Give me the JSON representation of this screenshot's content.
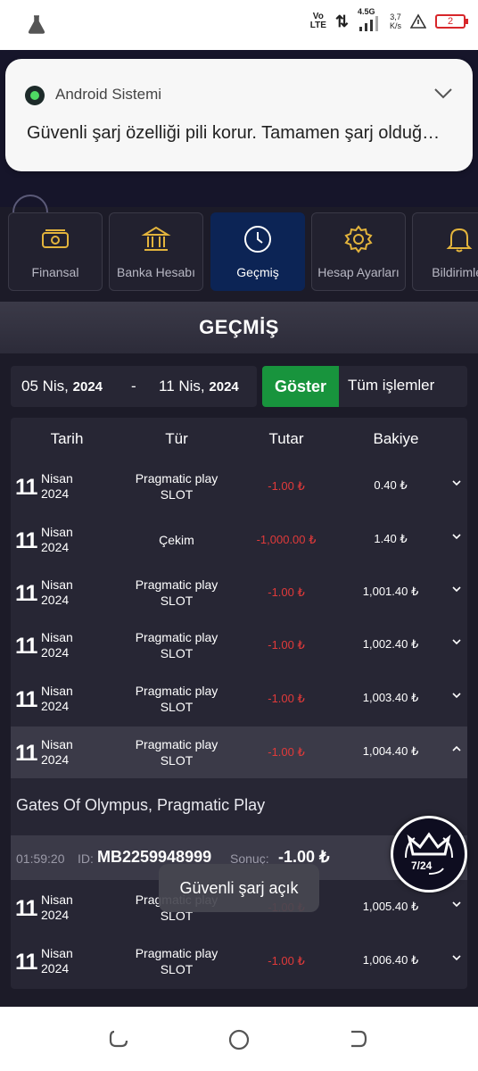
{
  "status_bar": {
    "volte": [
      "Vo",
      "LTE"
    ],
    "network": "4.5G",
    "speed": [
      "3,7",
      "K/s"
    ],
    "battery": "2",
    "icons": [
      "flask-icon",
      "signal-icon",
      "alert-icon",
      "battery-icon"
    ]
  },
  "notification": {
    "app_name": "Android Sistemi",
    "message": "Güvenli şarj özelliği pili korur. Tamamen şarj olduğ…"
  },
  "tabs": [
    {
      "label": "Finansal",
      "icon": "money-icon",
      "active": false
    },
    {
      "label": "Banka Hesabı",
      "icon": "bank-icon",
      "active": false
    },
    {
      "label": "Geçmiş",
      "icon": "clock-icon",
      "active": true
    },
    {
      "label": "Hesap Ayarları",
      "icon": "gear-icon",
      "active": false
    },
    {
      "label": "Bildirimler",
      "icon": "bell-icon",
      "active": false
    }
  ],
  "page_title": "GEÇMİŞ",
  "filter": {
    "start_day": "05 Nis,",
    "start_year": "2024",
    "separator": "-",
    "end_day": "11 Nis,",
    "end_year": "2024",
    "show_button": "Göster",
    "type_select": "Tüm işlemler"
  },
  "table": {
    "headers": {
      "date": "Tarih",
      "type": "Tür",
      "amount": "Tutar",
      "balance": "Bakiye"
    },
    "rows": [
      {
        "day": "11",
        "month": "Nisan",
        "year": "2024",
        "type1": "Pragmatic play",
        "type2": "SLOT",
        "amount": "-1.00 ₺",
        "balance": "0.40 ₺"
      },
      {
        "day": "11",
        "month": "Nisan",
        "year": "2024",
        "type1": "Çekim",
        "type2": "",
        "amount": "-1,000.00 ₺",
        "balance": "1.40 ₺"
      },
      {
        "day": "11",
        "month": "Nisan",
        "year": "2024",
        "type1": "Pragmatic play",
        "type2": "SLOT",
        "amount": "-1.00 ₺",
        "balance": "1,001.40 ₺"
      },
      {
        "day": "11",
        "month": "Nisan",
        "year": "2024",
        "type1": "Pragmatic play",
        "type2": "SLOT",
        "amount": "-1.00 ₺",
        "balance": "1,002.40 ₺"
      },
      {
        "day": "11",
        "month": "Nisan",
        "year": "2024",
        "type1": "Pragmatic play",
        "type2": "SLOT",
        "amount": "-1.00 ₺",
        "balance": "1,003.40 ₺"
      },
      {
        "day": "11",
        "month": "Nisan",
        "year": "2024",
        "type1": "Pragmatic play",
        "type2": "SLOT",
        "amount": "-1.00 ₺",
        "balance": "1,004.40 ₺"
      },
      {
        "day": "11",
        "month": "Nisan",
        "year": "2024",
        "type1": "Pragmatic play",
        "type2": "SLOT",
        "amount": "-1.00 ₺",
        "balance": "1,005.40 ₺"
      },
      {
        "day": "11",
        "month": "Nisan",
        "year": "2024",
        "type1": "Pragmatic play",
        "type2": "SLOT",
        "amount": "-1.00 ₺",
        "balance": "1,006.40 ₺"
      }
    ],
    "expanded_detail": {
      "game": "Gates Of Olympus,  Pragmatic Play",
      "time": "01:59:20",
      "id_label": "ID:",
      "id_value": "MB2259948999",
      "result_label": "Sonuç:",
      "result_value": "-1.00 ₺"
    }
  },
  "support_badge": "7/24",
  "toast": "Güvenli şarj açık",
  "colors": {
    "background": "#1c1b28",
    "panel": "#272634",
    "active_tab": "#0c2455",
    "show_button": "#18943d",
    "negative": "#e03a3a"
  }
}
